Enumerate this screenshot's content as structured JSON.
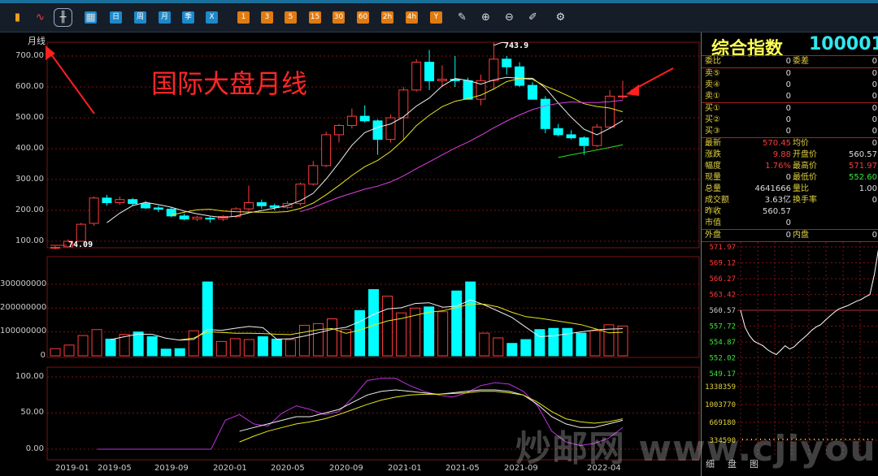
{
  "toolbar": {
    "buttons": [
      {
        "label": "",
        "icon": "bar-chart-icon",
        "style": "ico"
      },
      {
        "label": "",
        "icon": "line-chart-icon",
        "style": "ico"
      },
      {
        "label": "",
        "icon": "candlestick-icon",
        "style": "ico",
        "selected": true
      },
      {
        "label": "",
        "icon": "calendar-icon",
        "style": "blue"
      },
      {
        "label": "日",
        "icon": "",
        "style": "blue"
      },
      {
        "label": "周",
        "icon": "",
        "style": "blue"
      },
      {
        "label": "月",
        "icon": "",
        "style": "blue"
      },
      {
        "label": "季",
        "icon": "",
        "style": "blue"
      },
      {
        "label": "X",
        "icon": "",
        "style": "blue"
      },
      {
        "label": "1",
        "icon": "",
        "style": "orange"
      },
      {
        "label": "3",
        "icon": "",
        "style": "orange"
      },
      {
        "label": "5",
        "icon": "",
        "style": "orange"
      },
      {
        "label": "15",
        "icon": "",
        "style": "orange"
      },
      {
        "label": "30",
        "icon": "",
        "style": "orange"
      },
      {
        "label": "60",
        "icon": "",
        "style": "orange"
      },
      {
        "label": "2h",
        "icon": "",
        "style": "orange"
      },
      {
        "label": "4h",
        "icon": "",
        "style": "orange"
      },
      {
        "label": "Y",
        "icon": "",
        "style": "orange"
      },
      {
        "label": "",
        "icon": "draw-icon",
        "style": "ico"
      },
      {
        "label": "",
        "icon": "zoom-in-icon",
        "style": "ico"
      },
      {
        "label": "",
        "icon": "zoom-out-icon",
        "style": "ico"
      },
      {
        "label": "",
        "icon": "edit-icon",
        "style": "ico"
      },
      {
        "label": "",
        "icon": "gear-icon",
        "style": "ico"
      }
    ]
  },
  "chart": {
    "period_label": "月线",
    "annotation_title": "国际大盘月线",
    "high_label": "743.9",
    "low_label": "74.09",
    "price_ticks": [
      "700.00",
      "600.00",
      "500.00",
      "400.00",
      "300.00",
      "200.00",
      "100.00"
    ],
    "volume_ticks": [
      "300000000",
      "200000000",
      "100000000",
      "0"
    ],
    "osc_ticks": [
      "100.00",
      "50.00",
      "0.00"
    ],
    "x_labels": [
      "2019-01",
      "2019-05",
      "2019-09",
      "2020-01",
      "2020-05",
      "2020-09",
      "2021-01",
      "2021-05",
      "2021-09",
      "2022-04"
    ],
    "colors": {
      "up": "#ff3c3c",
      "down": "#00ffff",
      "grid": "#7a1414"
    }
  },
  "chart_data": [
    {
      "type": "candlestick",
      "title": "",
      "ylim": [
        100,
        750
      ],
      "series": [
        {
          "name": "",
          "ohlc": [
            [
              78,
              85,
              74,
              80
            ],
            [
              82,
              106,
              80,
              100
            ],
            [
              100,
              160,
              98,
              155
            ],
            [
              158,
              245,
              150,
              240
            ],
            [
              240,
              250,
              215,
              225
            ],
            [
              225,
              245,
              218,
              235
            ],
            [
              235,
              240,
              215,
              222
            ],
            [
              222,
              230,
              205,
              208
            ],
            [
              208,
              215,
              195,
              204
            ],
            [
              204,
              210,
              178,
              182
            ],
            [
              182,
              190,
              168,
              172
            ],
            [
              172,
              182,
              165,
              178
            ],
            [
              175,
              180,
              160,
              172
            ],
            [
              172,
              185,
              165,
              180
            ],
            [
              180,
              210,
              175,
              205
            ],
            [
              205,
              280,
              198,
              225
            ],
            [
              225,
              235,
              205,
              215
            ],
            [
              215,
              222,
              200,
              210
            ],
            [
              210,
              230,
              205,
              222
            ],
            [
              222,
              290,
              215,
              285
            ],
            [
              285,
              360,
              280,
              345
            ],
            [
              345,
              455,
              340,
              445
            ],
            [
              445,
              480,
              420,
              475
            ],
            [
              475,
              530,
              465,
              505
            ],
            [
              505,
              540,
              485,
              490
            ],
            [
              490,
              495,
              380,
              430
            ],
            [
              430,
              510,
              420,
              500
            ],
            [
              500,
              600,
              430,
              590
            ],
            [
              590,
              690,
              585,
              680
            ],
            [
              680,
              720,
              590,
              620
            ],
            [
              620,
              670,
              600,
              625
            ],
            [
              625,
              700,
              600,
              620
            ],
            [
              620,
              630,
              560,
              560
            ],
            [
              560,
              640,
              540,
              620
            ],
            [
              620,
              743.9,
              590,
              690
            ],
            [
              690,
              700,
              640,
              665
            ],
            [
              665,
              680,
              600,
              605
            ],
            [
              605,
              615,
              570,
              560
            ],
            [
              560,
              570,
              450,
              465
            ],
            [
              465,
              480,
              440,
              445
            ],
            [
              445,
              460,
              430,
              435
            ],
            [
              435,
              440,
              380,
              410
            ],
            [
              410,
              480,
              405,
              470
            ],
            [
              470,
              590,
              465,
              570
            ],
            [
              570,
              620,
              560,
              570.45
            ]
          ]
        }
      ]
    },
    {
      "type": "bar",
      "title": "",
      "ylim": [
        0,
        320000000
      ],
      "series": [
        {
          "name": "",
          "values": [
            30000000,
            45000000,
            85000000,
            110000000,
            70000000,
            90000000,
            100000000,
            80000000,
            28000000,
            30000000,
            105000000,
            310000000,
            60000000,
            72000000,
            68000000,
            80000000,
            70000000,
            68000000,
            128000000,
            135000000,
            155000000,
            110000000,
            190000000,
            278000000,
            250000000,
            180000000,
            200000000,
            205000000,
            185000000,
            272000000,
            310000000,
            95000000,
            75000000,
            52000000,
            68000000,
            110000000,
            115000000,
            115000000,
            95000000,
            105000000,
            130000000,
            125000000
          ]
        }
      ]
    },
    {
      "type": "line",
      "title": "",
      "ylim": [
        0,
        100
      ],
      "series": [
        {
          "name": "",
          "values": [
            0,
            0,
            0,
            0,
            0,
            0,
            0,
            0,
            0,
            40,
            48,
            35,
            32,
            50,
            60,
            55,
            48,
            52,
            72,
            95,
            98,
            98,
            88,
            80,
            75,
            72,
            78,
            88,
            92,
            90,
            80,
            60,
            25,
            10,
            5,
            8,
            15,
            30
          ]
        },
        {
          "name": "",
          "values": [
            0,
            0,
            0,
            0,
            0,
            0,
            0,
            0,
            0,
            0,
            25,
            30,
            35,
            40,
            45,
            45,
            50,
            55,
            65,
            75,
            80,
            82,
            80,
            78,
            76,
            78,
            80,
            82,
            82,
            80,
            75,
            62,
            45,
            35,
            30,
            30,
            35,
            40
          ]
        },
        {
          "name": "",
          "values": [
            0,
            0,
            0,
            0,
            0,
            0,
            0,
            0,
            0,
            0,
            10,
            18,
            25,
            30,
            35,
            38,
            42,
            48,
            55,
            62,
            68,
            72,
            75,
            76,
            76,
            77,
            78,
            80,
            80,
            78,
            75,
            65,
            52,
            42,
            38,
            36,
            38,
            42
          ]
        }
      ]
    }
  ],
  "quote_panel": {
    "name": "综合指数",
    "code": "100001",
    "rows_top": [
      {
        "l": "委比",
        "v": "0",
        "l2": "委差",
        "v2": "0"
      },
      {
        "l": "卖⑤",
        "v": "0",
        "l2": "",
        "v2": "0"
      },
      {
        "l": "卖④",
        "v": "0",
        "l2": "",
        "v2": "0"
      },
      {
        "l": "卖①",
        "v": "0",
        "l2": "",
        "v2": "0"
      },
      {
        "l": "买①",
        "v": "0",
        "l2": "",
        "v2": "0"
      },
      {
        "l": "买②",
        "v": "0",
        "l2": "",
        "v2": "0"
      },
      {
        "l": "买③",
        "v": "0",
        "l2": "",
        "v2": "0"
      }
    ],
    "rows_mid": [
      {
        "l": "最新",
        "v": "570.45",
        "vc": "red",
        "l2": "均价",
        "v2": "0",
        "v2c": "val"
      },
      {
        "l": "涨跌",
        "v": "9.88",
        "vc": "red",
        "l2": "开盘价",
        "v2": "560.57",
        "v2c": "val"
      },
      {
        "l": "幅度",
        "v": "1.76%",
        "vc": "red",
        "l2": "最高价",
        "v2": "571.97",
        "v2c": "red"
      },
      {
        "l": "现量",
        "v": "0",
        "vc": "val",
        "l2": "最低价",
        "v2": "552.60",
        "v2c": "green"
      },
      {
        "l": "总量",
        "v": "4641666",
        "vc": "val",
        "l2": "量比",
        "v2": "1.00",
        "v2c": "val"
      },
      {
        "l": "成交额",
        "v": "3.63亿",
        "vc": "val",
        "l2": "换手率",
        "v2": "0",
        "v2c": "val"
      },
      {
        "l": "昨收",
        "v": "560.57",
        "vc": "val",
        "l2": "",
        "v2": "",
        "v2c": "val"
      },
      {
        "l": "市值",
        "v": "0",
        "vc": "val",
        "l2": "",
        "v2": "",
        "v2c": "val"
      }
    ],
    "row_outer": {
      "l": "外盘",
      "v": "0",
      "l2": "内盘",
      "v2": "0"
    },
    "intraday_ticks": [
      "571.97",
      "569.12",
      "566.27",
      "563.42",
      "560.57",
      "557.72",
      "554.87",
      "552.02",
      "549.17"
    ],
    "intraday_vol_ticks": [
      "1338359",
      "1003770",
      "669180",
      "334590"
    ],
    "tabs": [
      "细",
      "盘",
      "图"
    ]
  },
  "watermark": "炒邮网 www.cjiyou.net"
}
